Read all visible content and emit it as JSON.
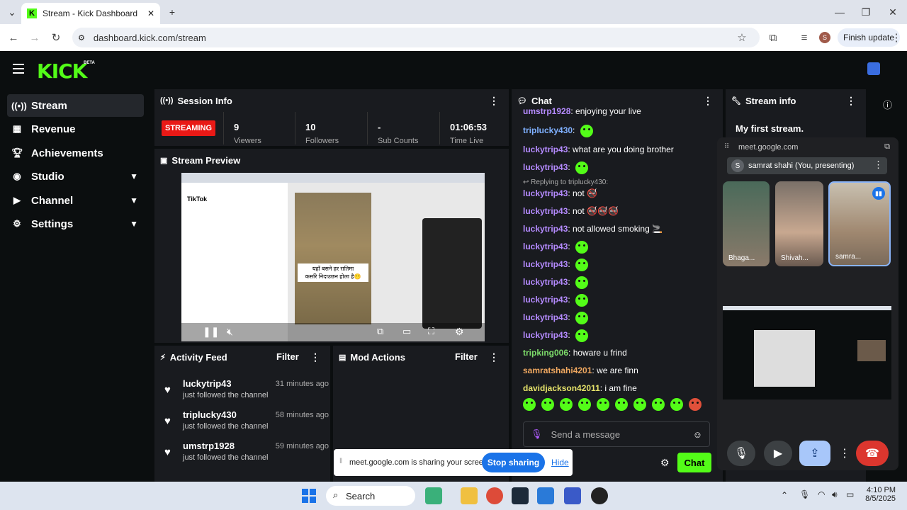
{
  "browser": {
    "tab_title": "Stream - Kick Dashboard",
    "favicon_letter": "K",
    "url": "dashboard.kick.com/stream",
    "finish_update": "Finish update",
    "profile_initial": "S"
  },
  "app": {
    "logo": "KICK",
    "beta": "BETA"
  },
  "sidebar": {
    "items": [
      {
        "label": "Stream",
        "icon": "broadcast-icon"
      },
      {
        "label": "Revenue",
        "icon": "chart-icon"
      },
      {
        "label": "Achievements",
        "icon": "trophy-icon"
      },
      {
        "label": "Studio",
        "icon": "studio-icon"
      },
      {
        "label": "Channel",
        "icon": "channel-icon"
      },
      {
        "label": "Settings",
        "icon": "gear-icon"
      }
    ]
  },
  "session_info": {
    "title": "Session Info",
    "status": "STREAMING",
    "stats": [
      {
        "value": "9",
        "label": "Viewers"
      },
      {
        "value": "10",
        "label": "Followers"
      },
      {
        "value": "-",
        "label": "Sub Counts"
      },
      {
        "value": "01:06:53",
        "label": "Time Live"
      }
    ]
  },
  "stream_preview": {
    "title": "Stream Preview",
    "caption_line1": "यहाँ बसने हर रातिमा",
    "caption_line2": "कसरि निदाउछन होला है😶"
  },
  "activity_feed": {
    "title": "Activity Feed",
    "filter": "Filter",
    "items": [
      {
        "name": "luckytrip43",
        "time": "31 minutes ago",
        "action": "just followed the channel"
      },
      {
        "name": "triplucky430",
        "time": "58 minutes ago",
        "action": "just followed the channel"
      },
      {
        "name": "umstrp1928",
        "time": "59 minutes ago",
        "action": "just followed the channel"
      }
    ]
  },
  "mod_actions": {
    "title": "Mod Actions",
    "filter": "Filter"
  },
  "chat": {
    "title": "Chat",
    "messages": [
      {
        "user": "umstrp1928",
        "text": "enjoying your live",
        "color": "#b58bff",
        "emote": false
      },
      {
        "user": "triplucky430",
        "text": "",
        "color": "#7fb0ff",
        "emote": true
      },
      {
        "user": "luckytrip43",
        "text": "what are you doing brother",
        "color": "#b58bff",
        "emote": false
      },
      {
        "user": "luckytrip43",
        "text": "",
        "color": "#b58bff",
        "emote": true
      },
      {
        "user": "luckytrip43",
        "text": "not 🚭",
        "color": "#b58bff",
        "emote": false
      },
      {
        "user": "luckytrip43",
        "text": "not 🚭🚭🚭",
        "color": "#b58bff",
        "emote": false
      },
      {
        "user": "luckytrip43",
        "text": "not allowed smoking 🚬",
        "color": "#b58bff",
        "emote": false
      },
      {
        "user": "luckytrip43",
        "text": "",
        "color": "#b58bff",
        "emote": true
      },
      {
        "user": "luckytrip43",
        "text": "",
        "color": "#b58bff",
        "emote": true
      },
      {
        "user": "luckytrip43",
        "text": "",
        "color": "#b58bff",
        "emote": true
      },
      {
        "user": "luckytrip43",
        "text": "",
        "color": "#b58bff",
        "emote": true
      },
      {
        "user": "luckytrip43",
        "text": "",
        "color": "#b58bff",
        "emote": true
      },
      {
        "user": "luckytrip43",
        "text": "",
        "color": "#b58bff",
        "emote": true
      },
      {
        "user": "tripking006",
        "text": "howare u frind",
        "color": "#7ddc6a",
        "emote": false
      },
      {
        "user": "samratshahi4201",
        "text": "we are finn",
        "color": "#f0a860",
        "emote": false
      },
      {
        "user": "davidjackson42011",
        "text": "i am fine",
        "color": "#e6e36a",
        "emote": false
      }
    ],
    "reply_note": "Replying to triplucky430:",
    "input_placeholder": "Send a message",
    "send_label": "Chat"
  },
  "stream_info": {
    "title": "Stream info",
    "stream_title": "My first stream."
  },
  "meet": {
    "domain": "meet.google.com",
    "presenting": "samrat shahi (You, presenting)",
    "presenter_initial": "S",
    "participants": [
      "Bhaga...",
      "Shivah...",
      "samra..."
    ]
  },
  "share_bar": {
    "text": "meet.google.com is sharing your screen.",
    "stop": "Stop sharing",
    "hide": "Hide"
  },
  "taskbar": {
    "search": "Search",
    "time": "4:10 PM",
    "date": "8/5/2025"
  },
  "colors": {
    "accent": "#53fc18",
    "live": "#e91916",
    "panel": "#191b1f"
  }
}
